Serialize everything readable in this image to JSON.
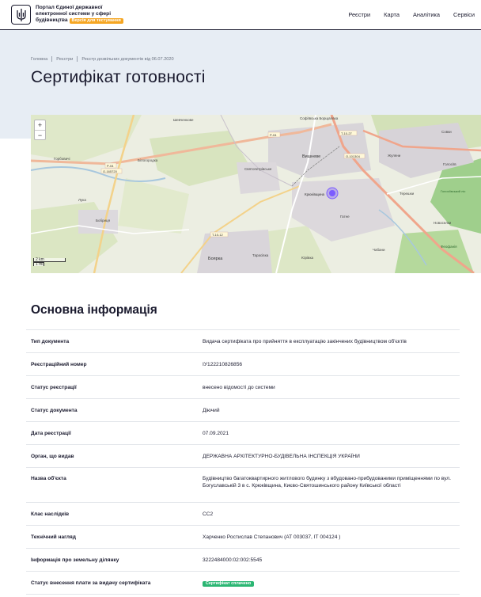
{
  "header": {
    "brand_line1": "Портал Єдиної державної",
    "brand_line2": "електронної системи у сфері",
    "brand_line3": "будівництва",
    "test_badge": "Версія для тестування",
    "nav": [
      "Реєстри",
      "Карта",
      "Аналітика",
      "Сервіси"
    ]
  },
  "breadcrumb": [
    "Головна",
    "Реєстри",
    "Реєстр дозвільних документів від 06.07.2020"
  ],
  "page_title": "Сертифікат готовності",
  "map": {
    "zoom_in": "+",
    "zoom_out": "−",
    "scale_km": "2 km",
    "scale_mi": "1 mi",
    "labels": {
      "shevchenkove": "Шевченкове",
      "sofiivska": "Софіївська Борщагівка",
      "horbovychi": "Горбовичі",
      "bilohorodka": "Білогородка",
      "sviatopetrivske": "Святопетрівське",
      "vyshneve": "Вишневе",
      "kriukivshchyna": "Крюківщина",
      "hatne": "Гатне",
      "luka": "Лука",
      "boiarka": "Боярка",
      "tarasivka": "Тарасівка",
      "iurivka": "Юрівка",
      "chabany": "Чабани",
      "zhuliany": "Жуляни",
      "tereshky": "Терешки",
      "holosiiv": "Голосіїв",
      "sovky": "Совки",
      "novoselky": "Новоселки",
      "feofaniia": "Феофанія",
      "holosiivskyi": "Голосіївський ліс",
      "bobrytsia": "Бобриця"
    },
    "road_labels": {
      "r04a": "P-04",
      "r04b": "P-04",
      "o165720": "O-165720",
      "t1027": "T-10-27",
      "o101304": "O-101304",
      "t1012": "T-10-12"
    },
    "accent": "#7c5cff"
  },
  "section_title": "Основна інформація",
  "info_rows": [
    {
      "label": "Тип документа",
      "value": "Видача сертифіката про прийняття в експлуатацію закінчених будівництвом об'єктів"
    },
    {
      "label": "Реєстраційний номер",
      "value": "ІУ122210826856"
    },
    {
      "label": "Статус реєстрації",
      "value": "внесено відомості до системи"
    },
    {
      "label": "Статус документа",
      "value": "Діючий"
    },
    {
      "label": "Дата реєстрації",
      "value": "07.09.2021"
    },
    {
      "label": "Орган, що видав",
      "value": "ДЕРЖАВНА АРХІТЕКТУРНО-БУДІВЕЛЬНА ІНСПЕКЦІЯ УКРАЇНИ"
    },
    {
      "label": "Назва об'єкта",
      "value": "Будівництво багатоквартирного житлового будинку з вбудовано-прибудованими приміщеннями по вул. Богуславській 3 в с. Крюківщина, Києво-Святошинського району Київської області"
    },
    {
      "label": "Клас наслідків",
      "value": "СС2"
    },
    {
      "label": "Технічний нагляд",
      "value": "Харченко Ростислав Степанович (АТ 003037, ІТ 004124 )"
    },
    {
      "label": "Інформація про земельну ділянку",
      "value": "3222484000:02:002:5545"
    },
    {
      "label": "Статус внесення плати за видачу сертифіката",
      "value": "Сертифікат сплачено"
    }
  ]
}
